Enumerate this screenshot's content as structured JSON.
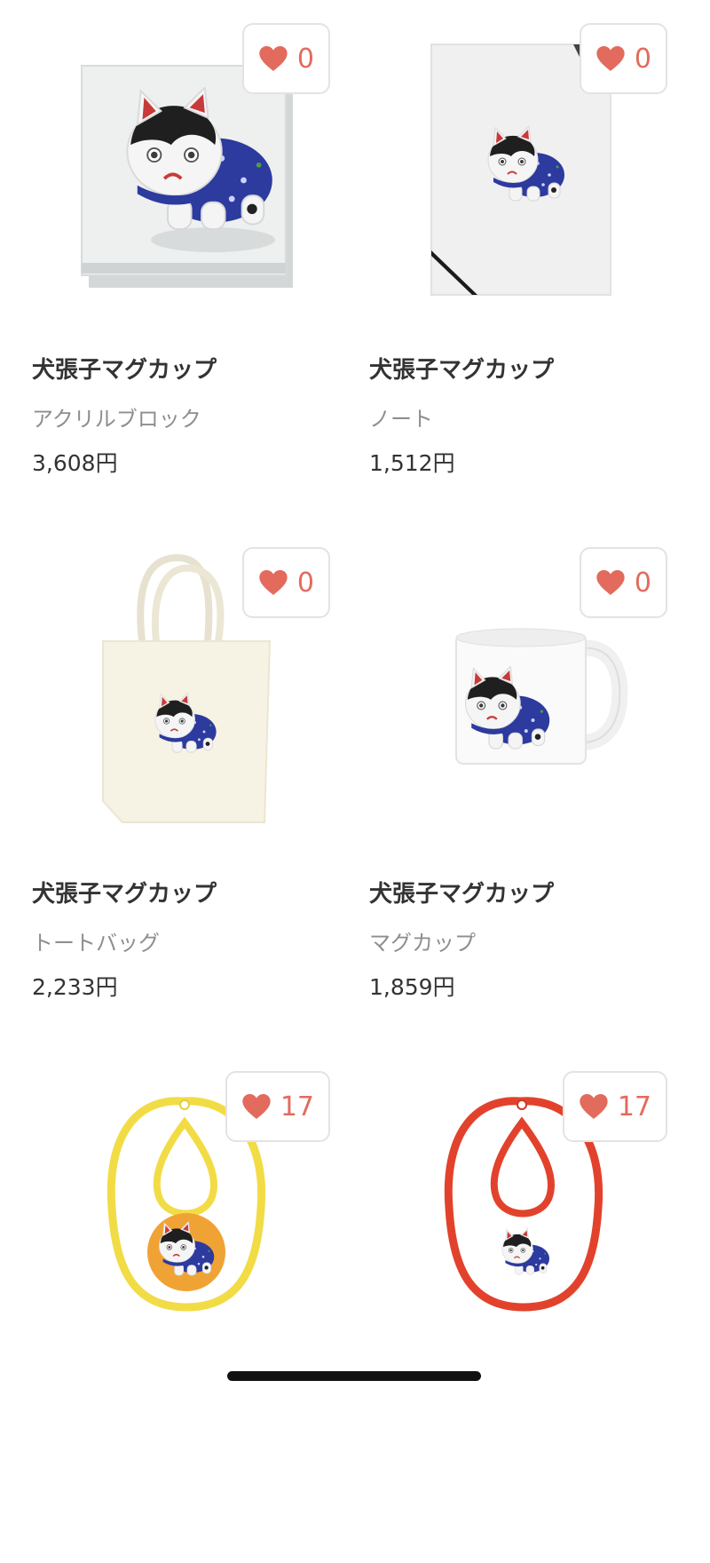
{
  "products": [
    {
      "title": "犬張子マグカップ",
      "type": "アクリルブロック",
      "price": "3,608円",
      "likes": "0",
      "image": "acrylic-block"
    },
    {
      "title": "犬張子マグカップ",
      "type": "ノート",
      "price": "1,512円",
      "likes": "0",
      "image": "notebook"
    },
    {
      "title": "犬張子マグカップ",
      "type": "トートバッグ",
      "price": "2,233円",
      "likes": "0",
      "image": "tote-bag"
    },
    {
      "title": "犬張子マグカップ",
      "type": "マグカップ",
      "price": "1,859円",
      "likes": "0",
      "image": "mug"
    },
    {
      "title": "",
      "type": "",
      "price": "",
      "likes": "17",
      "image": "bib-yellow"
    },
    {
      "title": "",
      "type": "",
      "price": "",
      "likes": "17",
      "image": "bib-red"
    }
  ],
  "colors": {
    "heart": "#e26b5d",
    "title": "#333333",
    "subtitle": "#8e8e8e",
    "card_border": "#e3e3e3"
  },
  "icons": {
    "like": "heart-icon"
  }
}
